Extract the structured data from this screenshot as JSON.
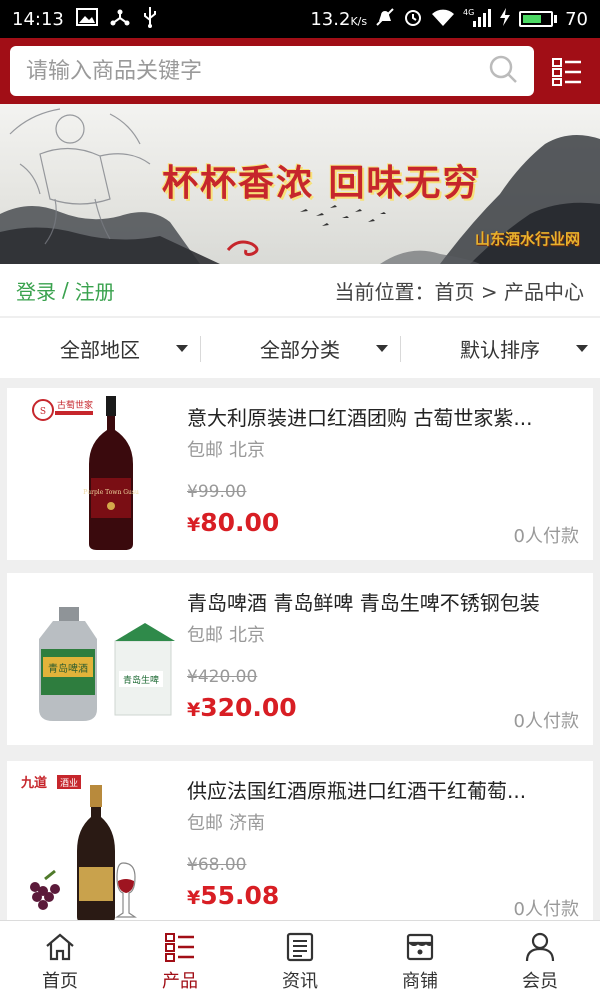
{
  "status_bar": {
    "time": "14:13",
    "speed": "13.2",
    "speed_unit": "K/s",
    "network": "4G",
    "battery": "70",
    "battery_level": 0.7
  },
  "search": {
    "placeholder": "请输入商品关键字",
    "value": ""
  },
  "banner": {
    "slogan": "杯杯香浓 回味无穷",
    "site_name": "山东酒水行业网"
  },
  "info_row": {
    "login": "登录",
    "separator": "/",
    "register": "注册",
    "breadcrumb": "当前位置：首页 > 产品中心"
  },
  "filters": [
    {
      "label": "全部地区"
    },
    {
      "label": "全部分类"
    },
    {
      "label": "默认排序"
    }
  ],
  "products": [
    {
      "title": "意大利原装进口红酒团购 古萄世家紫...",
      "shipping": "包邮",
      "city": "北京",
      "old_price": "¥99.00",
      "price_symbol": "¥",
      "price": "80.00",
      "paid": "0人付款",
      "image_text": "古萄世家",
      "bottle_label": "Purple Town Gusu"
    },
    {
      "title": "青岛啤酒 青岛鲜啤 青岛生啤不锈钢包装",
      "shipping": "包邮",
      "city": "北京",
      "old_price": "¥420.00",
      "price_symbol": "¥",
      "price": "320.00",
      "paid": "0人付款",
      "image_text": "青岛啤酒",
      "box_label": "青岛生啤"
    },
    {
      "title": "供应法国红酒原瓶进口红酒干红葡萄...",
      "shipping": "包邮",
      "city": "济南",
      "old_price": "¥68.00",
      "price_symbol": "¥",
      "price": "55.08",
      "paid": "0人付款",
      "image_text": "九道",
      "image_text_2": "酒业"
    }
  ],
  "tabs": [
    {
      "label": "首页",
      "icon": "home-icon"
    },
    {
      "label": "产品",
      "icon": "list-icon"
    },
    {
      "label": "资讯",
      "icon": "news-icon"
    },
    {
      "label": "商铺",
      "icon": "shop-icon"
    },
    {
      "label": "会员",
      "icon": "user-icon"
    }
  ],
  "colors": {
    "brand": "#a10e16",
    "price": "#d81e24",
    "login": "#3aa24e",
    "muted": "#999999"
  }
}
